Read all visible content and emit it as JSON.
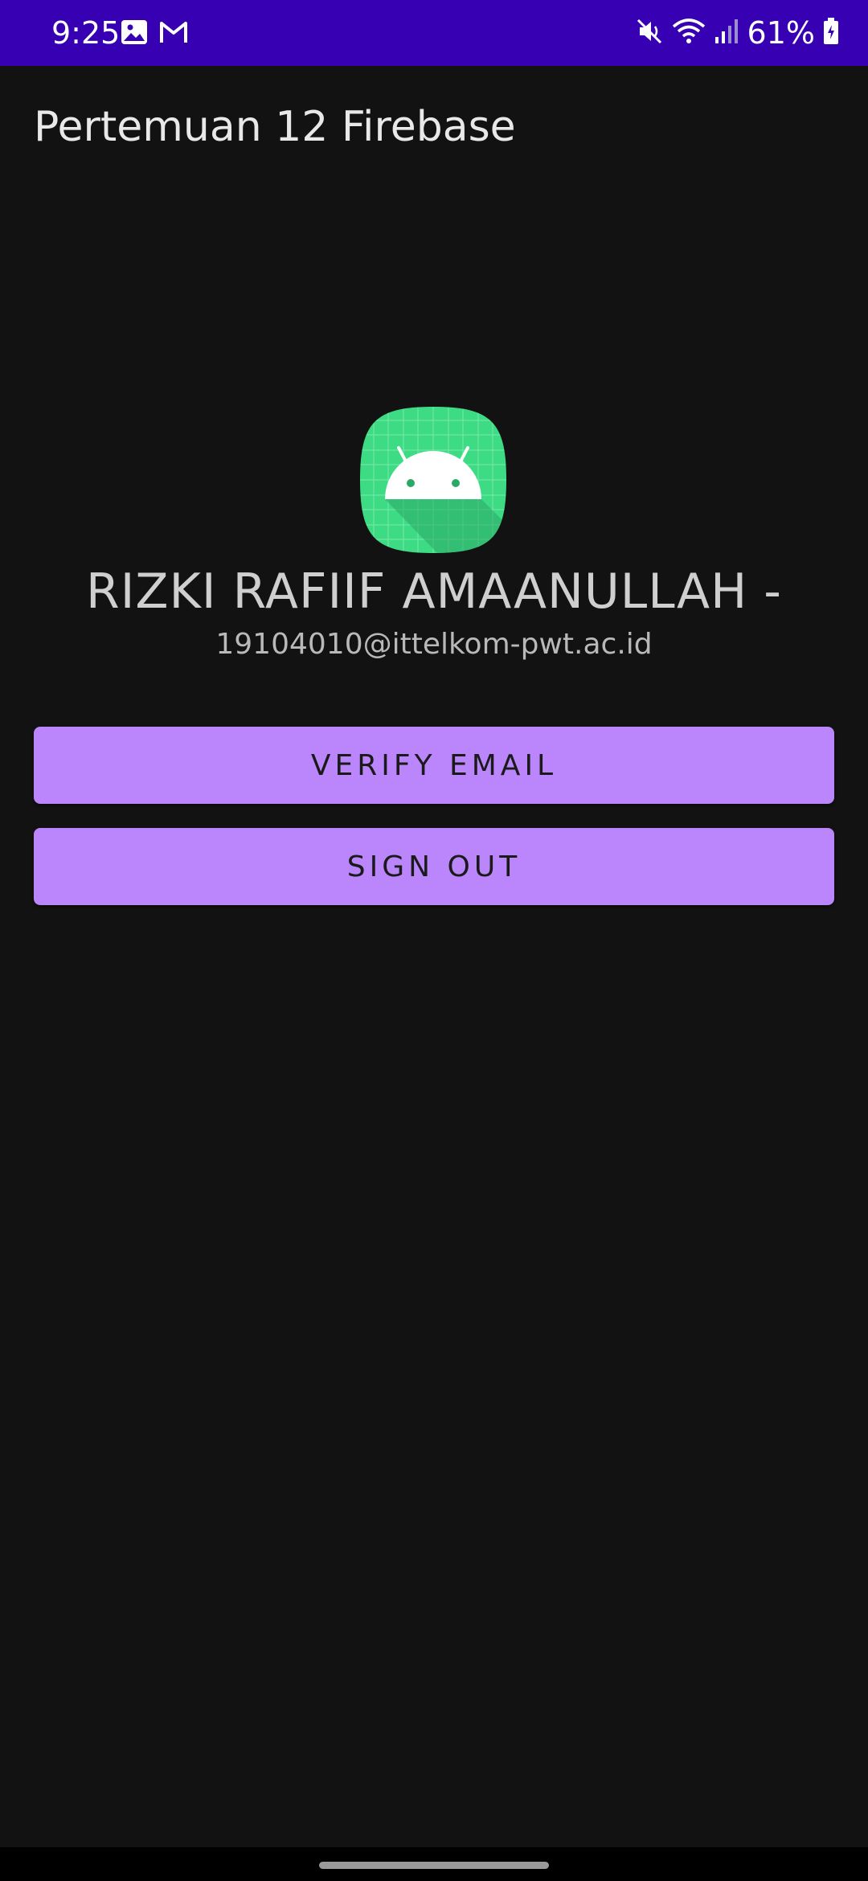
{
  "status_bar": {
    "time": "9:25",
    "left_icons": [
      "image-icon",
      "gmail-icon"
    ],
    "right_icons": [
      "mute-icon",
      "wifi-icon",
      "signal-icon",
      "battery-icon"
    ],
    "battery_percent": "61%",
    "background": "#3700b3"
  },
  "app_bar": {
    "title": "Pertemuan 12 Firebase"
  },
  "profile": {
    "avatar_icon": "android-icon",
    "name": "RIZKI RAFIIF AMAANULLAH -",
    "email": "19104010@ittelkom-pwt.ac.id"
  },
  "actions": {
    "verify_label": "VERIFY EMAIL",
    "signout_label": "SIGN OUT",
    "button_color": "#bb86fc"
  },
  "theme": {
    "background": "#121212"
  }
}
